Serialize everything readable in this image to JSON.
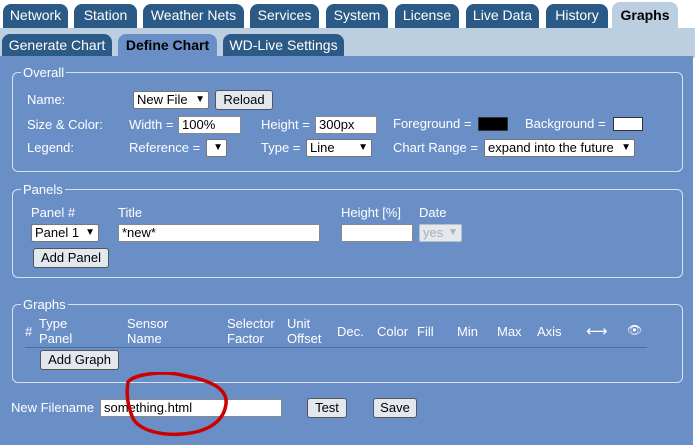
{
  "tabs": [
    {
      "label": "Network"
    },
    {
      "label": "Station"
    },
    {
      "label": "Weather Nets"
    },
    {
      "label": "Services"
    },
    {
      "label": "System"
    },
    {
      "label": "License"
    },
    {
      "label": "Live Data"
    },
    {
      "label": "History"
    },
    {
      "label": "Graphs"
    }
  ],
  "active_tab": "Graphs",
  "subtabs": [
    {
      "label": "Generate Chart"
    },
    {
      "label": "Define Chart"
    },
    {
      "label": "WD-Live Settings"
    }
  ],
  "active_subtab": "Define Chart",
  "overall": {
    "legend": "Overall",
    "name_label": "Name:",
    "name_value": "New File",
    "reload_label": "Reload",
    "size_color_label": "Size & Color:",
    "width_label": "Width =",
    "width_value": "100%",
    "height_label": "Height =",
    "height_value": "300px",
    "foreground_label": "Foreground =",
    "foreground_color": "#000000",
    "background_label": "Background =",
    "background_color": "#ffffff",
    "legend_label": "Legend:",
    "reference_label": "Reference =",
    "reference_value": "",
    "type_label": "Type =",
    "type_value": "Line",
    "chart_range_label": "Chart Range =",
    "chart_range_value": "expand into the future"
  },
  "panels": {
    "legend": "Panels",
    "col_panel": "Panel #",
    "col_title": "Title",
    "col_height": "Height [%]",
    "col_date": "Date",
    "panel_value": "Panel 1",
    "title_value": "*new*",
    "height_value": "",
    "date_value": "yes",
    "add_panel_label": "Add Panel"
  },
  "graphs": {
    "legend": "Graphs",
    "col_num": "#",
    "col_type_1": "Type",
    "col_type_2": "Panel",
    "col_sensor_1": "Sensor",
    "col_sensor_2": "Name",
    "col_selector_1": "Selector",
    "col_selector_2": "Factor",
    "col_unit_1": "Unit",
    "col_unit_2": "Offset",
    "col_dec": "Dec.",
    "col_color": "Color",
    "col_fill": "Fill",
    "col_min": "Min",
    "col_max": "Max",
    "col_axis": "Axis",
    "col_arrow": "⟷",
    "col_eye": "👁",
    "add_graph_label": "Add Graph"
  },
  "footer": {
    "new_filename_label": "New Filename",
    "filename_value": "something.html",
    "test_label": "Test",
    "save_label": "Save"
  },
  "colors": {
    "tab_bg": "#2b5a86",
    "active_tab_bg": "#bccfe0",
    "panel_bg": "#6a8fc7",
    "annotation_circle": "#cc0000"
  }
}
